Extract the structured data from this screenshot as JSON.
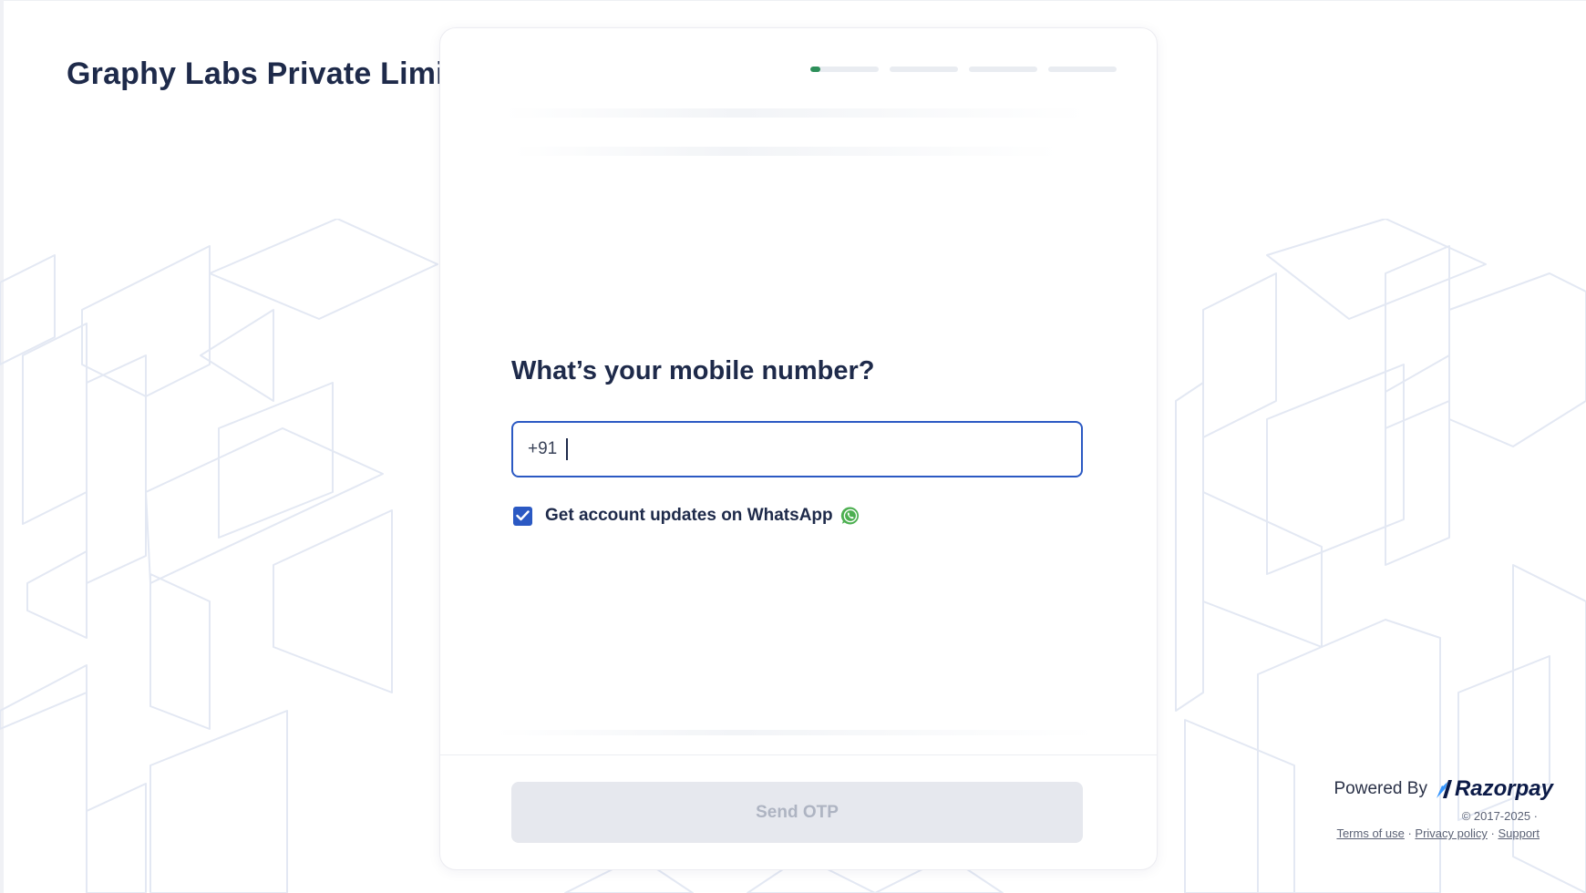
{
  "merchant": {
    "name": "Graphy Labs Private Limite"
  },
  "progress": {
    "steps": 4,
    "current_step": 1,
    "current_step_fill": 0.15,
    "accent": "#2d8f5a"
  },
  "login": {
    "title": "What’s your mobile number?",
    "country_code": "+91",
    "phone_value": "",
    "whatsapp_label": "Get account updates on WhatsApp",
    "whatsapp_checked": true,
    "send_otp_label": "Send OTP"
  },
  "footer": {
    "powered_by": "Powered By",
    "brand": "Razorpay",
    "copyright": "© 2017-2025 ·",
    "links": [
      "Terms of use",
      "Privacy policy",
      "Support"
    ],
    "separator": " · "
  },
  "icons": {
    "whatsapp": "whatsapp-icon",
    "checkbox": "checkmark-icon",
    "brand_logo": "razorpay-logo-icon"
  },
  "colors": {
    "primary": "#2b59c3",
    "heading": "#1e2a4a",
    "disabled_bg": "#e6e8ee",
    "disabled_text": "#aeb4c2",
    "whatsapp": "#4caf50"
  }
}
